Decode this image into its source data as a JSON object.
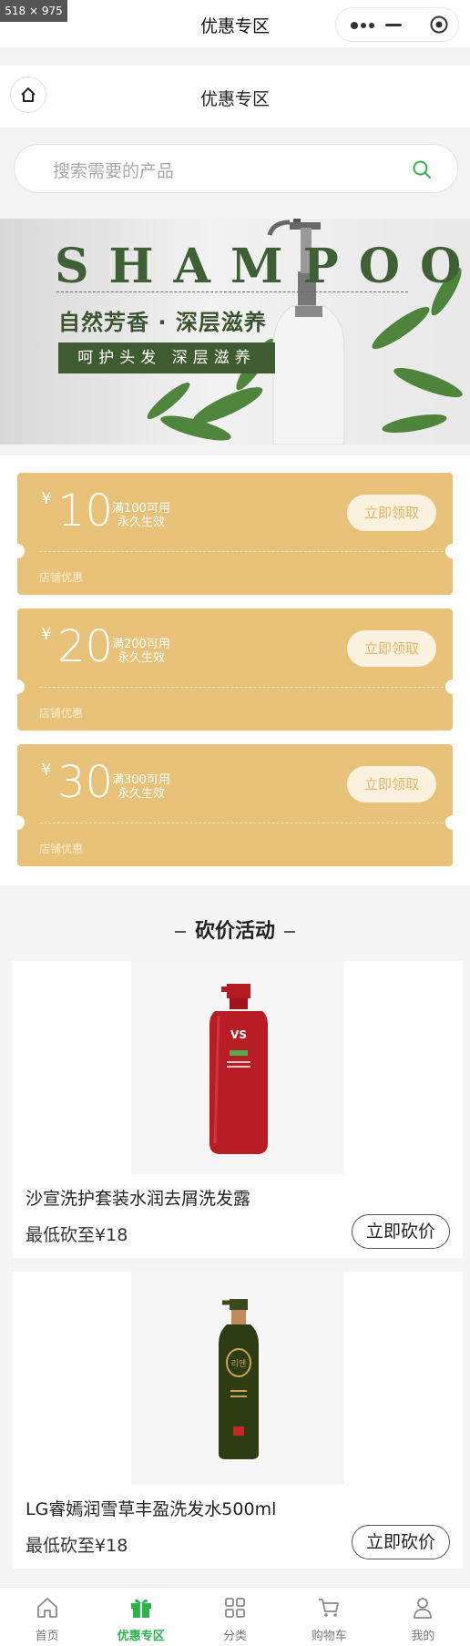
{
  "overlay": {
    "dimension_badge": "518 × 975"
  },
  "topbar": {
    "title": "优惠专区"
  },
  "page": {
    "title": "优惠专区"
  },
  "search": {
    "placeholder": "搜索需要的产品"
  },
  "banner": {
    "headline": "SHAMPOO",
    "slogan": "自然芳香 · 深层滋养",
    "tagline": "呵护头发  深层滋养"
  },
  "coupons": [
    {
      "yen": "¥",
      "amount": "10",
      "condition": "满100可用",
      "validity": "永久生效",
      "button": "立即领取",
      "shop": "店铺优惠"
    },
    {
      "yen": "¥",
      "amount": "20",
      "condition": "满200可用",
      "validity": "永久生效",
      "button": "立即领取",
      "shop": "店铺优惠"
    },
    {
      "yen": "¥",
      "amount": "30",
      "condition": "满300可用",
      "validity": "永久生效",
      "button": "立即领取",
      "shop": "店铺优惠"
    }
  ],
  "bargain": {
    "title": "砍价活动",
    "products": [
      {
        "name": "沙宣洗护套装水润去屑洗发露",
        "price_label": "最低砍至",
        "price": "¥18",
        "button": "立即砍价"
      },
      {
        "name": "LG睿嫣润雪草丰盈洗发水500ml",
        "price_label": "最低砍至",
        "price": "¥18",
        "button": "立即砍价"
      }
    ]
  },
  "tabbar": {
    "items": [
      {
        "label": "首页",
        "icon": "home-icon",
        "active": false
      },
      {
        "label": "优惠专区",
        "icon": "gift-icon",
        "active": true
      },
      {
        "label": "分类",
        "icon": "category-icon",
        "active": false
      },
      {
        "label": "购物车",
        "icon": "cart-icon",
        "active": false
      },
      {
        "label": "我的",
        "icon": "user-icon",
        "active": false
      }
    ]
  },
  "colors": {
    "accent_green": "#2bb34a",
    "coupon_gold": "#e8c278",
    "banner_green": "#3e5c30"
  }
}
